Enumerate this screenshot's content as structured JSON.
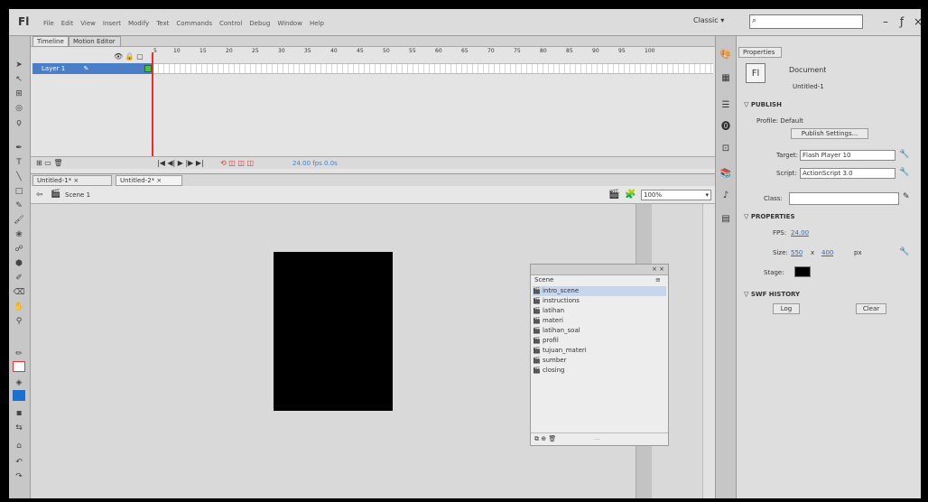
{
  "app": {
    "logo": "Fl"
  },
  "menu": [
    "File",
    "Edit",
    "View",
    "Insert",
    "Modify",
    "Text",
    "Commands",
    "Control",
    "Debug",
    "Window",
    "Help"
  ],
  "workspace": "Classic",
  "window_buttons": {
    "minimize": "–",
    "restore": "ƒ",
    "close": "×"
  },
  "timeline": {
    "tabs": [
      "Timeline",
      "Motion Editor"
    ],
    "frame_numbers": [
      "5",
      "10",
      "15",
      "20",
      "25",
      "30",
      "35",
      "40",
      "45",
      "50",
      "55",
      "60",
      "65",
      "70",
      "75",
      "80",
      "85",
      "90",
      "95",
      "100"
    ],
    "layer": "Layer 1",
    "footer_info": "24.00 fps 0.0s"
  },
  "documents": {
    "tabs": [
      "Untitled-1*",
      "Untitled-2*"
    ]
  },
  "editbar": {
    "scene": "Scene 1",
    "zoom": "100%"
  },
  "scenes": {
    "title": "Scene",
    "items": [
      "intro_scene",
      "instructions",
      "latihan",
      "materi",
      "latihan_soal",
      "profil",
      "tujuan_materi",
      "sumber",
      "closing"
    ],
    "footer": "..."
  },
  "properties": {
    "tab": "Properties",
    "logo": "Fl",
    "doc_type": "Document",
    "doc_name": "Untitled-1",
    "sections": {
      "publish": "PUBLISH",
      "properties": "PROPERTIES",
      "swf_history": "SWF HISTORY"
    },
    "profile_label": "Profile: Default",
    "publish_settings_btn": "Publish Settings...",
    "target_label": "Target:",
    "target_value": "Flash Player 10",
    "script_label": "Script:",
    "script_value": "ActionScript 3.0",
    "class_label": "Class:",
    "fps_label": "FPS:",
    "fps_value": "24.00",
    "size_label": "Size:",
    "size_w": "550",
    "size_x": "x",
    "size_h": "400",
    "size_unit": "px",
    "stage_label": "Stage:",
    "stage_color": "#000000",
    "log_btn": "Log",
    "clear_btn": "Clear"
  }
}
